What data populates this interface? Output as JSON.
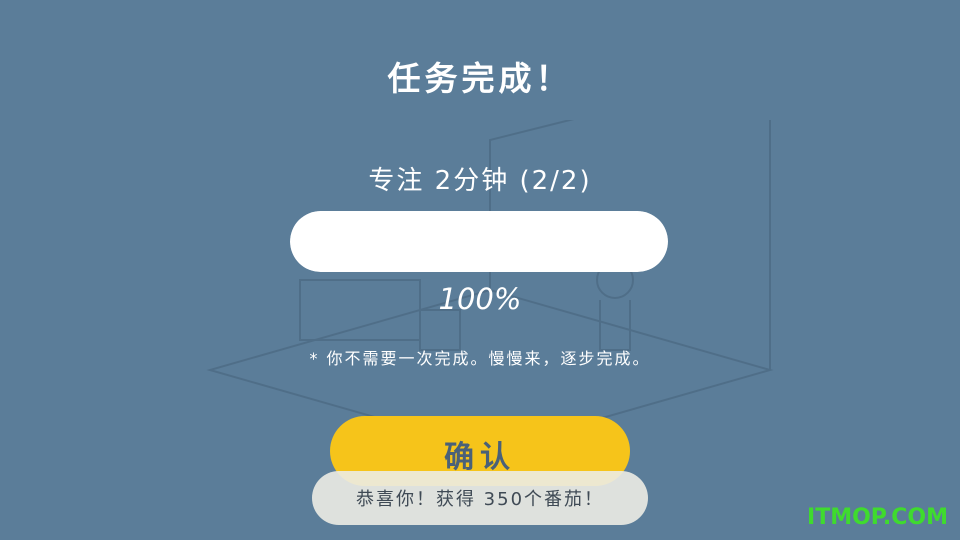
{
  "dialog": {
    "title": "任务完成！",
    "task_label": "专注 2分钟 (2/2)",
    "progress": 1.0,
    "percent_text": "100%",
    "hint": "* 你不需要一次完成。慢慢来，逐步完成。",
    "confirm_label": "确认"
  },
  "toast": {
    "message": "恭喜你！获得 350个番茄！"
  },
  "watermark": {
    "text": "ITMOP.COM"
  },
  "colors": {
    "background": "#5b7d99",
    "confirm": "#f6c41a",
    "watermark": "#3fdb2e"
  }
}
